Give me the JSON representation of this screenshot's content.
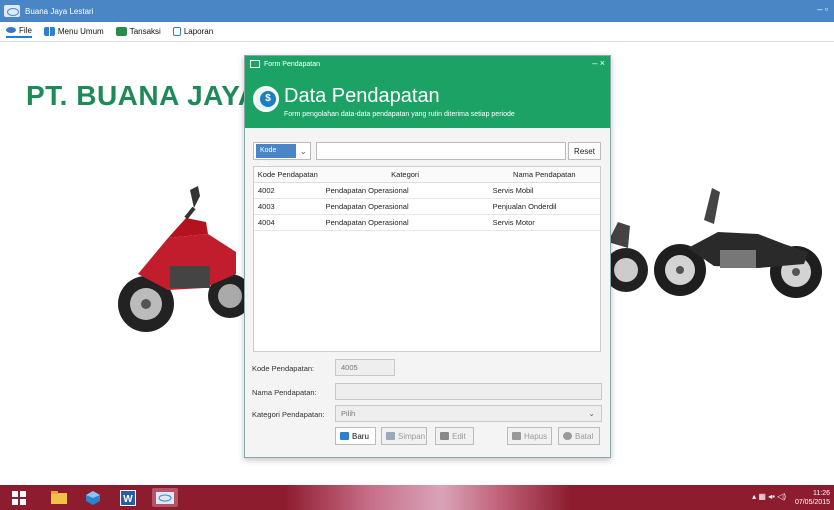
{
  "app": {
    "title": "Buana Jaya Lestari",
    "window_controls": "– ▫"
  },
  "menu": [
    {
      "label": "File",
      "icon": "file-icon"
    },
    {
      "label": "Menu Umum",
      "icon": "grid-icon"
    },
    {
      "label": "Tansaksi",
      "icon": "transaction-icon"
    },
    {
      "label": "Laporan",
      "icon": "report-icon"
    }
  ],
  "company": "PT. BUANA JAYA",
  "dialog": {
    "window_title": "Form Pendapatan",
    "window_controls": "–  ×",
    "header_title": "Data Pendapatan",
    "header_subtitle": "Form pengolahan data-data pendapatan yang rutin diterima setiap periode",
    "filter": {
      "selected": "Kode Pe...",
      "search_value": "",
      "reset_label": "Reset"
    },
    "table": {
      "columns": [
        "Kode Pendapatan",
        "Kategori",
        "Nama Pendapatan"
      ],
      "rows": [
        [
          "4002",
          "Pendapatan Operasional",
          "Servis Mobil"
        ],
        [
          "4003",
          "Pendapatan Operasional",
          "Penjualan Onderdil"
        ],
        [
          "4004",
          "Pendapatan Operasional",
          "Servis Motor"
        ]
      ]
    },
    "form": {
      "kode_label": "Kode Pendapatan:",
      "kode_value": "4005",
      "nama_label": "Nama Pendapatan:",
      "nama_value": "",
      "kategori_label": "Kategori Pendapatan:",
      "kategori_value": "Pilih"
    },
    "buttons": {
      "baru": "Baru",
      "simpan": "Simpan",
      "edit": "Edit",
      "hapus": "Hapus",
      "batal": "Batal"
    }
  },
  "taskbar": {
    "time": "11:26",
    "date": "07/05/2015"
  },
  "colors": {
    "accent_green": "#1ca265",
    "title_blue": "#4a86c5",
    "taskbar": "#8e1c2f"
  }
}
